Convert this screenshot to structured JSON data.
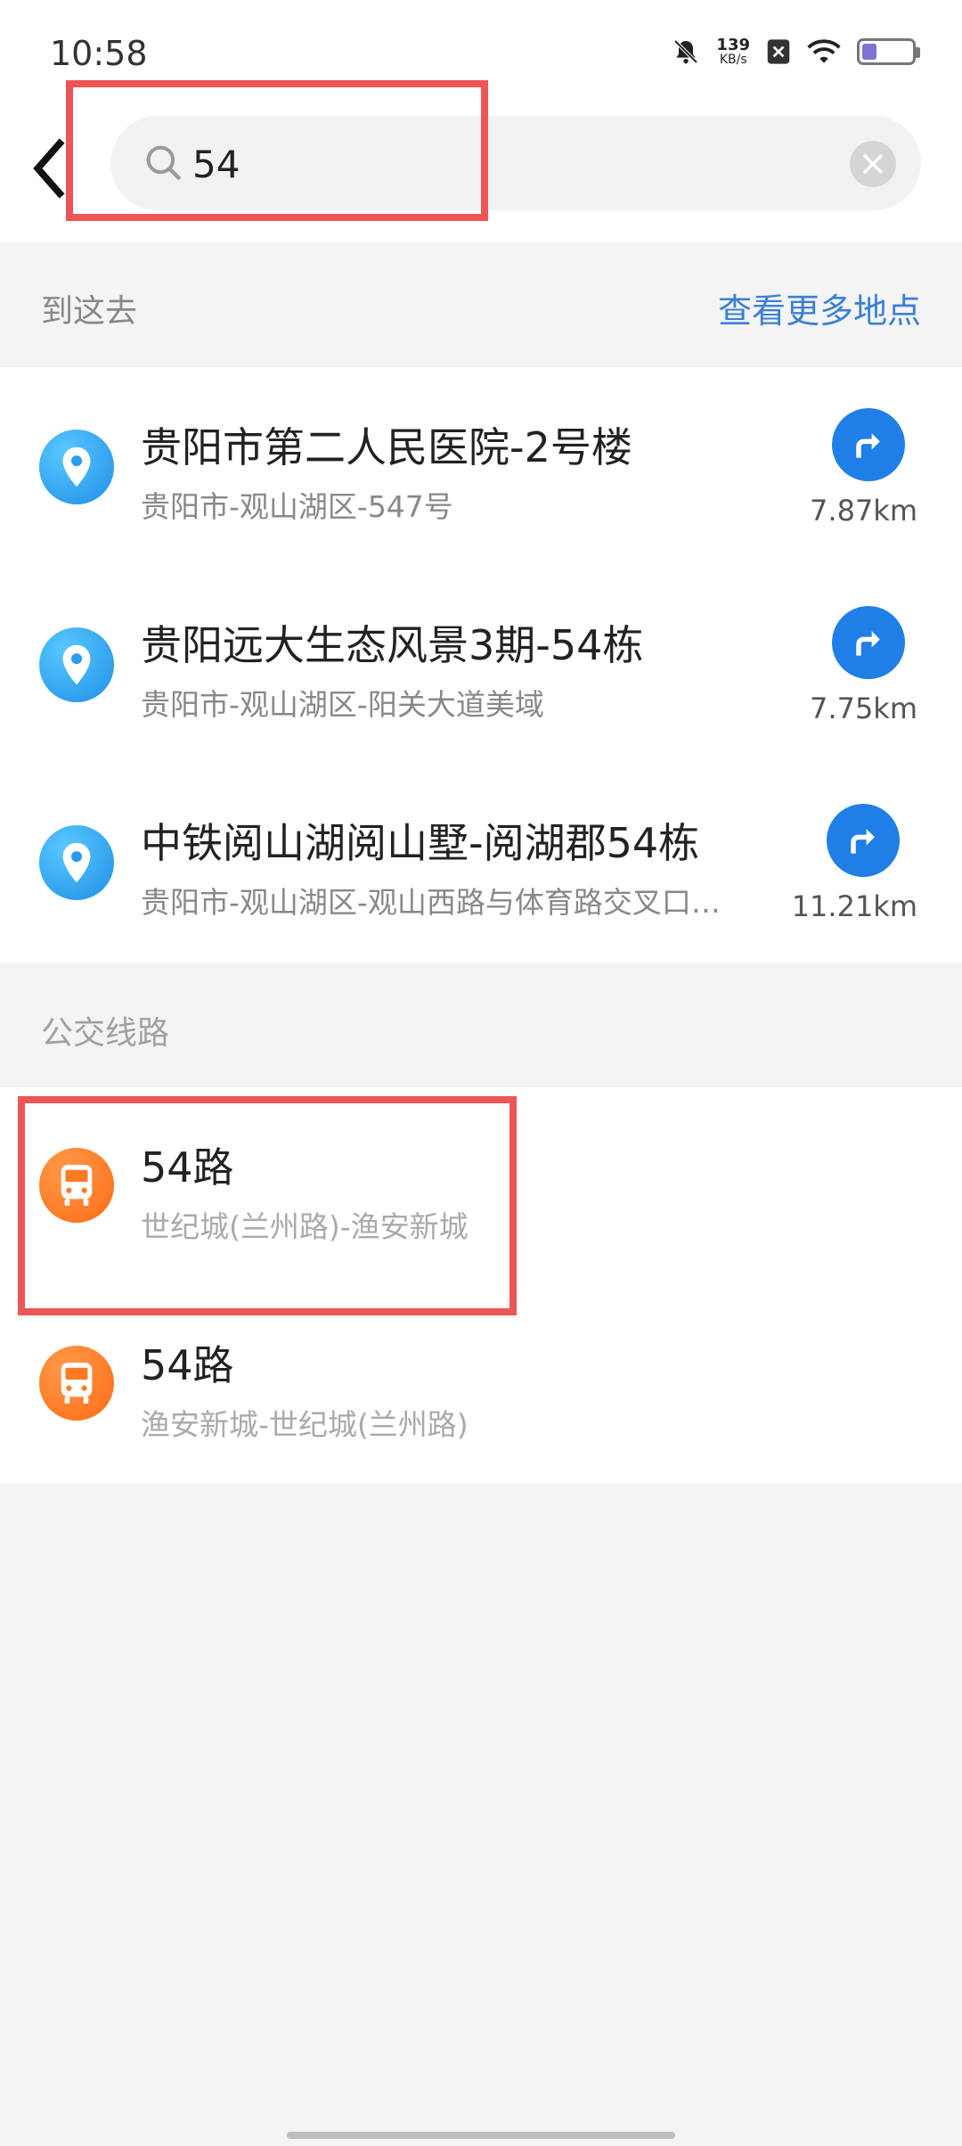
{
  "status_bar": {
    "time": "10:58",
    "net_speed_value": "139",
    "net_speed_unit": "KB/s",
    "icons": [
      "mute-bell-icon",
      "sim-x-icon",
      "wifi-icon",
      "battery-icon"
    ]
  },
  "search": {
    "query": "54",
    "back_icon": "chevron-left-icon",
    "search_icon": "magnifier-icon",
    "clear_icon": "close-icon"
  },
  "places_section": {
    "title": "到这去",
    "more_link": "查看更多地点",
    "items": [
      {
        "name": "贵阳市第二人民医院-2号楼",
        "address": "贵阳市-观山湖区-547号",
        "distance": "7.87km"
      },
      {
        "name": "贵阳远大生态风景3期-54栋",
        "address": "贵阳市-观山湖区-阳关大道美域",
        "distance": "7.75km"
      },
      {
        "name": "中铁阅山湖阅山墅-阅湖郡54栋",
        "address": "贵阳市-观山湖区-观山西路与体育路交叉口…",
        "distance": "11.21km"
      }
    ]
  },
  "bus_section": {
    "title": "公交线路",
    "routes": [
      {
        "name": "54路",
        "direction": "世纪城(兰州路)-渔安新城"
      },
      {
        "name": "54路",
        "direction": "渔安新城-世纪城(兰州路)"
      }
    ]
  },
  "colors": {
    "accent_blue": "#1f7fe6",
    "link_blue": "#3a7fd8",
    "bus_orange": "#ff6a14",
    "highlight_red": "#ee5555"
  }
}
